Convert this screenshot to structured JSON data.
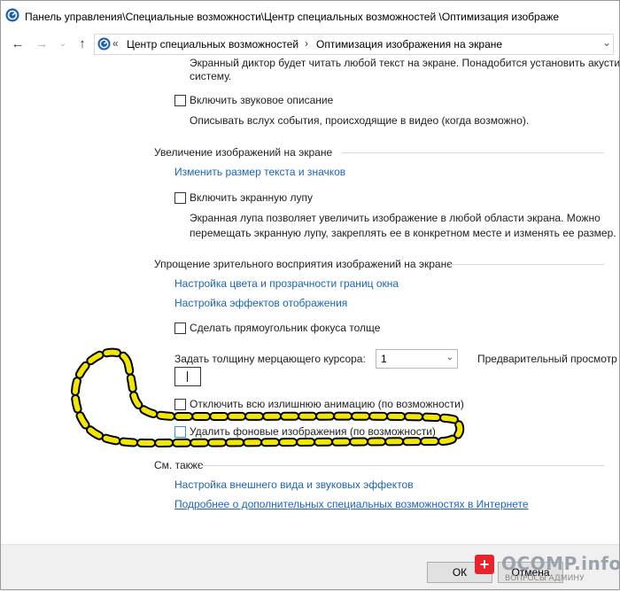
{
  "window": {
    "title": "Панель управления\\Специальные возможности\\Центр специальных возможностей  \\Оптимизация изображе"
  },
  "address_bar": {
    "separator_start": "«",
    "crumbs": [
      "Центр специальных возможностей",
      "Оптимизация изображения на экране"
    ],
    "separator": "›"
  },
  "content": {
    "narrator_desc_line1": "Экранный диктор будет читать любой текст на экране. Понадобится установить акустическ",
    "narrator_desc_line2": "систему.",
    "audio_desc_label": "Включить звуковое описание",
    "audio_desc_text": "Описывать вслух события, происходящие в видео (когда возможно).",
    "magnify": {
      "header": "Увеличение изображений на экране",
      "link_resize": "Изменить размер текста и значков",
      "magnifier_label": "Включить экранную лупу",
      "magnifier_desc_line1": "Экранная лупа позволяет увеличить изображение в любой области экрана. Можно",
      "magnifier_desc_line2": "перемещать экранную лупу, закреплять ее в конкретном месте и изменять ее размер."
    },
    "simplify": {
      "header": "Упрощение зрительного восприятия изображений на экране",
      "link_color": "Настройка цвета и прозрачности границ окна",
      "link_effects": "Настройка эффектов отображения",
      "focus_label": "Сделать прямоугольник фокуса толще",
      "cursor_label": "Задать толщину мерцающего курсора:",
      "cursor_value": "1",
      "preview_label": "Предварительный просмотр",
      "animation_label": "Отключить всю излишнюю анимацию (по возможности)",
      "background_label": "Удалить фоновые изображения (по возможности)"
    },
    "see_also": {
      "header": "См. также",
      "link_appearance": "Настройка внешнего вида и звуковых эффектов",
      "link_online": "Подробнее о дополнительных специальных возможностях в Интернете"
    }
  },
  "buttons": {
    "ok": "ОК",
    "cancel": "Отмена"
  },
  "watermark": {
    "main": "OCOMP.info",
    "sub": "ВОПРОСЫ АДМИНУ"
  },
  "colors": {
    "link": "#1c64b4",
    "annotation": "#f2e600",
    "checkbox_highlight": "#3d8ee0"
  }
}
